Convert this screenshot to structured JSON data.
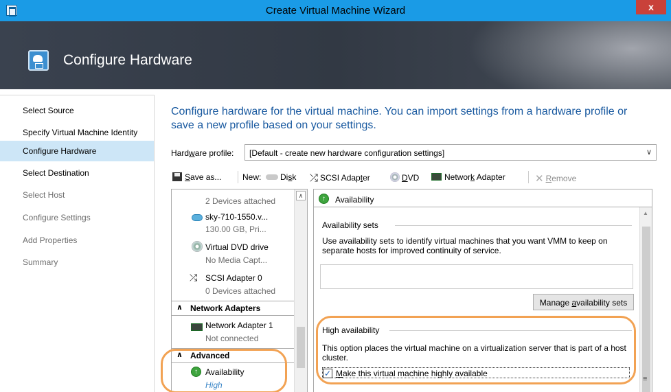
{
  "window": {
    "title": "Create Virtual Machine Wizard",
    "close_label": "x"
  },
  "header": {
    "title": "Configure Hardware",
    "icon": "hardware-wizard-icon"
  },
  "nav": {
    "items": [
      {
        "label": "Select Source",
        "state": "done"
      },
      {
        "label": "Specify Virtual Machine Identity",
        "state": "done"
      },
      {
        "label": "Configure Hardware",
        "state": "active"
      },
      {
        "label": "Select Destination",
        "state": "pending"
      },
      {
        "label": "Select Host",
        "state": "dim"
      },
      {
        "label": "Configure Settings",
        "state": "dim"
      },
      {
        "label": "Add Properties",
        "state": "dim"
      },
      {
        "label": "Summary",
        "state": "dim"
      }
    ]
  },
  "main": {
    "intro": "Configure hardware for the virtual machine. You can import settings from a hardware profile or save a new profile based on your settings.",
    "hardware_profile": {
      "label_pre": "Hard",
      "label_u": "w",
      "label_post": "are profile:",
      "value": "[Default - create new hardware configuration settings]"
    },
    "toolbar": {
      "save_u": "S",
      "save_rest": "ave as...",
      "new_label": "New:",
      "disk_pre": "Di",
      "disk_u": "s",
      "disk_post": "k",
      "scsi_pre": "SCSI Adap",
      "scsi_u": "t",
      "scsi_post": "er",
      "dvd_u": "D",
      "dvd_rest": "VD",
      "net_pre": "Networ",
      "net_u": "k",
      "net_post": " Adapter",
      "remove_u": "R",
      "remove_rest": "emove"
    },
    "tree": {
      "ide_status": "2 Devices attached",
      "disk_name": "sky-710-1550.v...",
      "disk_detail": "130.00 GB, Pri...",
      "dvd_name": "Virtual DVD drive",
      "dvd_detail": "No Media Capt...",
      "scsi_name": "SCSI Adapter 0",
      "scsi_detail": "0 Devices attached",
      "group_network": "Network Adapters",
      "nic_name": "Network Adapter 1",
      "nic_detail": "Not connected",
      "group_advanced": "Advanced",
      "avail_name": "Availability",
      "avail_detail": "High"
    },
    "panel": {
      "title": "Availability",
      "sets_label": "Availability sets",
      "sets_desc": "Use availability sets to identify virtual machines that you want VMM to keep on separate hosts for improved continuity of service.",
      "manage_pre": "Manage ",
      "manage_u": "a",
      "manage_post": "vailability sets",
      "ha_label": "High availability",
      "ha_desc": "This option places the virtual machine on a virtualization server that is part of a host cluster.",
      "ha_check_u": "M",
      "ha_check_rest": "ake this virtual machine highly available",
      "ha_checked": true
    }
  },
  "colors": {
    "titlebar": "#1a9be6",
    "intro_text": "#1a5aa0",
    "active_nav": "#cde6f7",
    "highlight": "#f2a253",
    "close": "#c9413a"
  }
}
